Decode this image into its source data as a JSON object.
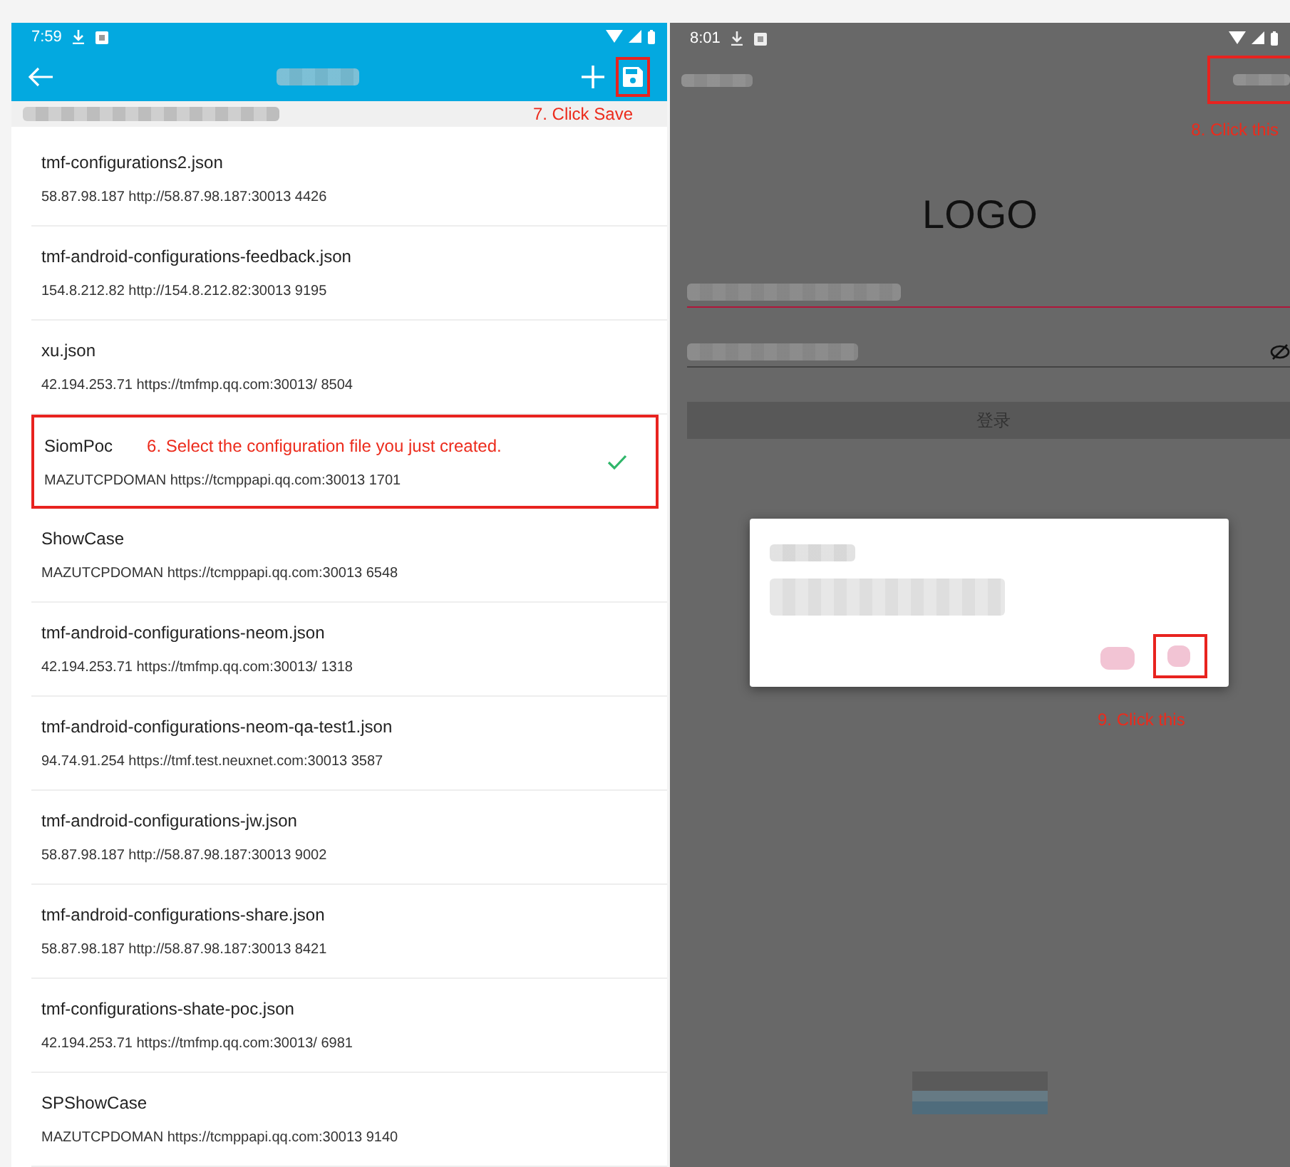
{
  "left_screen": {
    "status_bar": {
      "time": "7:59"
    },
    "save_annotation": "7. Click Save",
    "configs": [
      {
        "name": "tmf-configurations2.json",
        "detail": "58.87.98.187 http://58.87.98.187:30013 4426",
        "selected": false
      },
      {
        "name": "tmf-android-configurations-feedback.json",
        "detail": "154.8.212.82 http://154.8.212.82:30013 9195",
        "selected": false
      },
      {
        "name": "xu.json",
        "detail": "42.194.253.71 https://tmfmp.qq.com:30013/ 8504",
        "selected": false
      },
      {
        "name": "SiomPoc",
        "detail": "MAZUTCPDOMAN https://tcmppapi.qq.com:30013 1701",
        "selected": true,
        "annotation": "6. Select the configuration file you just created."
      },
      {
        "name": "ShowCase",
        "detail": "MAZUTCPDOMAN https://tcmppapi.qq.com:30013 6548",
        "selected": false
      },
      {
        "name": "tmf-android-configurations-neom.json",
        "detail": "42.194.253.71 https://tmfmp.qq.com:30013/ 1318",
        "selected": false
      },
      {
        "name": "tmf-android-configurations-neom-qa-test1.json",
        "detail": "94.74.91.254 https://tmf.test.neuxnet.com:30013 3587",
        "selected": false
      },
      {
        "name": "tmf-android-configurations-jw.json",
        "detail": "58.87.98.187 http://58.87.98.187:30013 9002",
        "selected": false
      },
      {
        "name": "tmf-android-configurations-share.json",
        "detail": "58.87.98.187 http://58.87.98.187:30013 8421",
        "selected": false
      },
      {
        "name": "tmf-configurations-shate-poc.json",
        "detail": "42.194.253.71 https://tmfmp.qq.com:30013/ 6981",
        "selected": false
      },
      {
        "name": "SPShowCase",
        "detail": "MAZUTCPDOMAN https://tcmppapi.qq.com:30013 9140",
        "selected": false
      }
    ]
  },
  "right_screen": {
    "status_bar": {
      "time": "8:01"
    },
    "top_annotation": "8. Click this",
    "logo": "LOGO",
    "login_button": "登录",
    "dialog_annotation": "9. Click this"
  }
}
